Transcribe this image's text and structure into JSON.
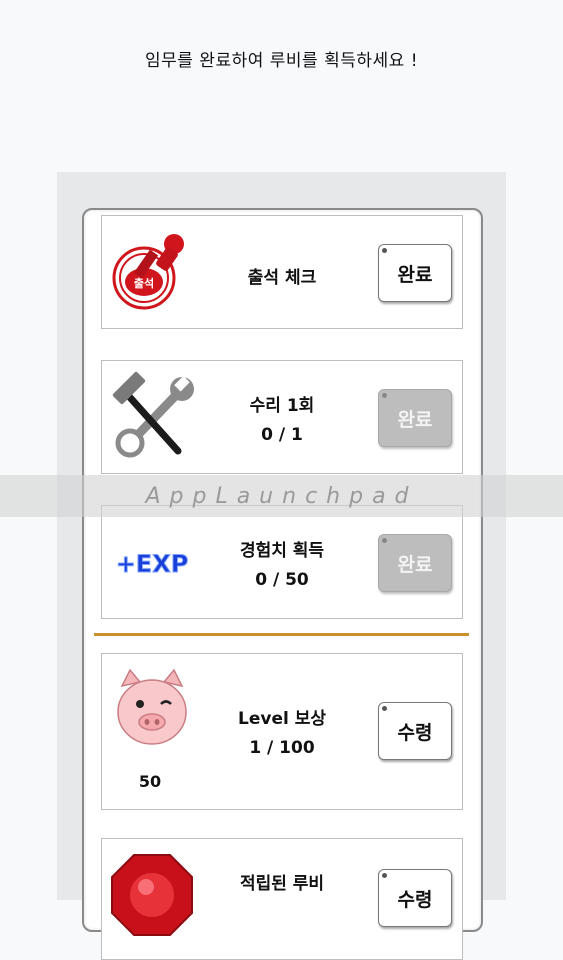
{
  "header": {
    "text": "임무를 완료하여 루비를 획득하세요 !"
  },
  "missions": [
    {
      "title": "출석 체크",
      "progress": "",
      "button": "완료",
      "icon": "attendance-stamp-icon",
      "stamp_text": "출석"
    },
    {
      "title": "수리 1회",
      "progress": "0 / 1",
      "button": "완료",
      "icon": "repair-tools-icon"
    },
    {
      "title": "경험치 획득",
      "progress": "0 / 50",
      "button": "완료",
      "icon": "exp-icon",
      "icon_text": "+EXP"
    }
  ],
  "rewards": [
    {
      "title": "Level 보상",
      "progress": "1 / 100",
      "button": "수령",
      "icon": "pig-icon",
      "value": "50"
    },
    {
      "title": "적립된 루비",
      "progress": "",
      "button": "수령",
      "icon": "ruby-icon"
    }
  ],
  "watermark": "AppLaunchpad",
  "colors": {
    "divider": "#c8912c",
    "disabled_button": "#bdbdbd",
    "stamp_red": "#d0161c"
  }
}
